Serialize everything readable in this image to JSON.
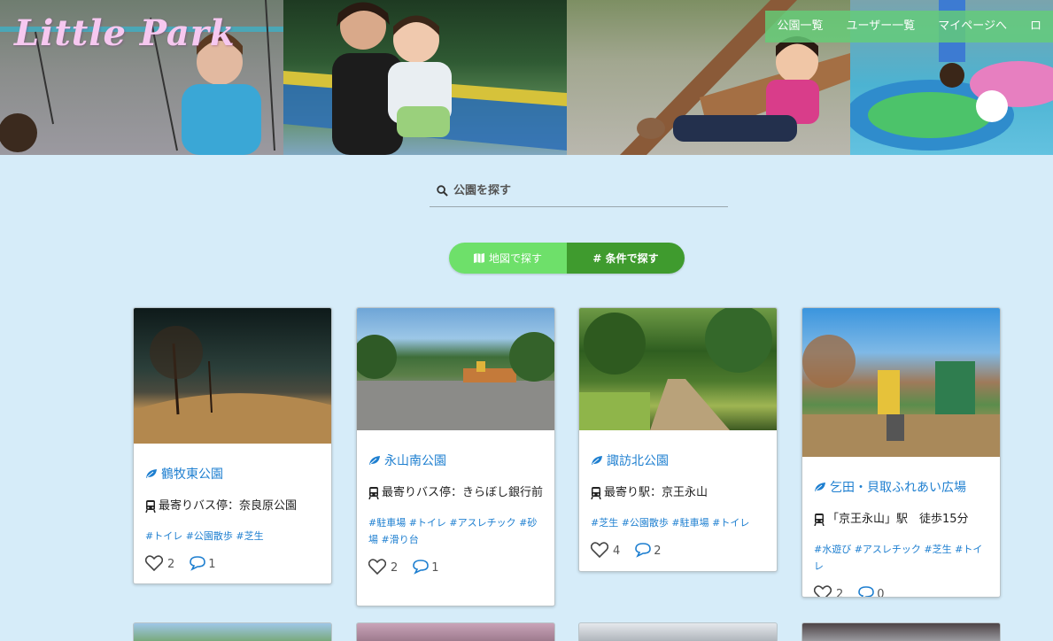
{
  "header": {
    "logo": "Little Park",
    "nav": [
      "公園一覧",
      "ユーザー一覧",
      "マイページへ",
      "ロ"
    ]
  },
  "search": {
    "placeholder": "公園を探す"
  },
  "toggle": {
    "map_label": "地図で探す",
    "condition_label": "# 条件で探す"
  },
  "cards": [
    {
      "name": "鶴牧東公園",
      "access": "最寄りバス停：奈良原公園",
      "tags": "#トイレ #公園散歩 #芝生",
      "likes": "2",
      "comments": "1"
    },
    {
      "name": "永山南公園",
      "access": "最寄りバス停：きらぼし銀行前",
      "tags": "#駐車場 #トイレ #アスレチック #砂場 #滑り台",
      "likes": "2",
      "comments": "1"
    },
    {
      "name": "諏訪北公園",
      "access": "最寄り駅：京王永山",
      "tags": "#芝生 #公園散歩 #駐車場 #トイレ",
      "likes": "4",
      "comments": "2"
    },
    {
      "name": "乞田・貝取ふれあい広場",
      "access": "「京王永山」駅　徒歩15分",
      "tags": "#水遊び #アスレチック #芝生 #トイレ",
      "likes": "2",
      "comments": "0"
    }
  ],
  "colors": {
    "background": "#d6ecf9",
    "nav_bg": "#64cd78",
    "tab_map": "#6ee06a",
    "tab_condition": "#3f9b2e",
    "link": "#1e7fd0",
    "logo": "#f6c8f0"
  },
  "icons": [
    "search-icon",
    "map-icon",
    "leaf-icon",
    "bus-icon",
    "heart-icon",
    "comment-icon"
  ]
}
